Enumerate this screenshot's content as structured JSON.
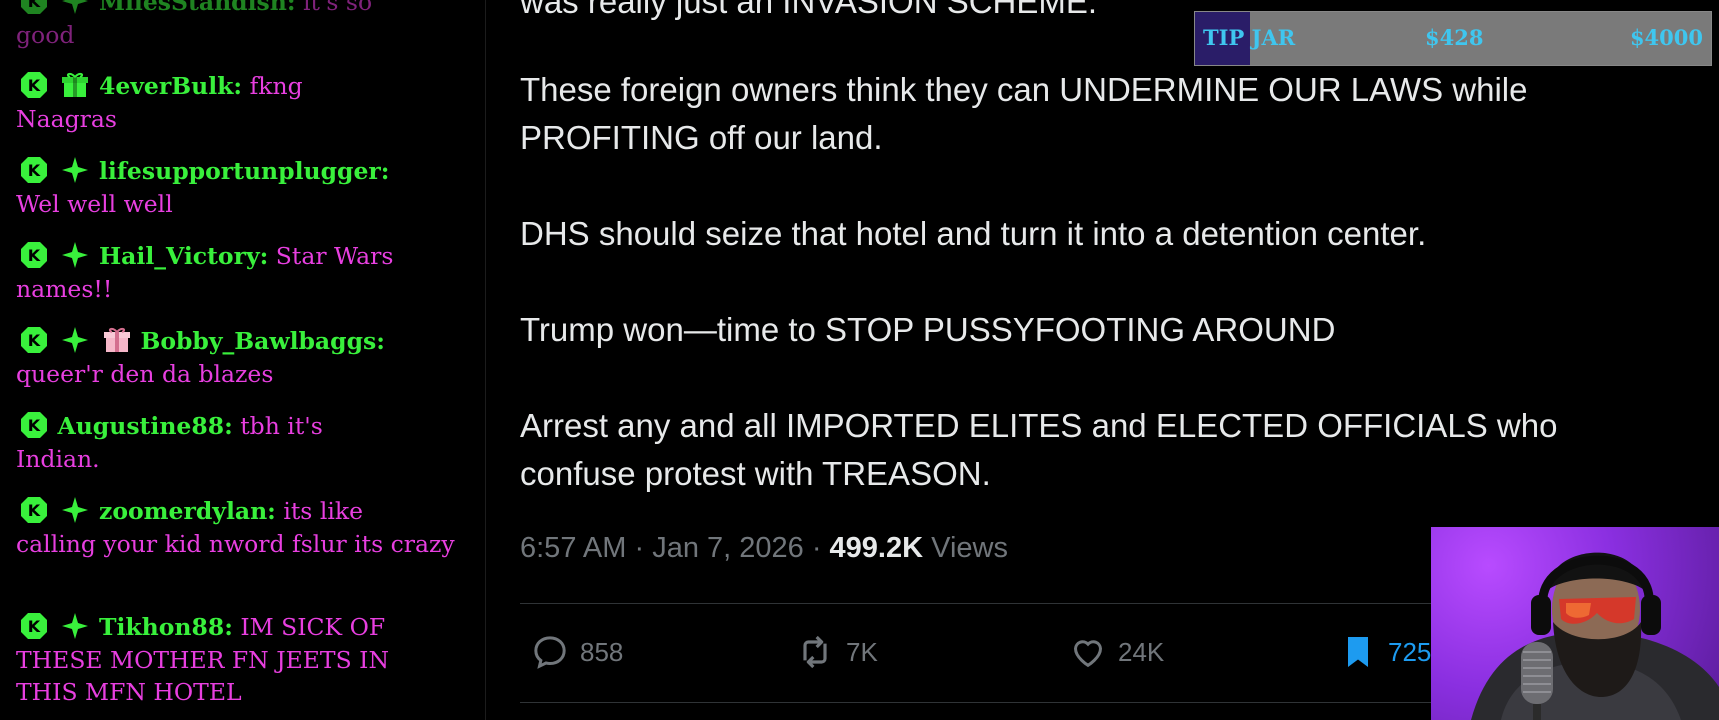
{
  "chat": {
    "messages": [
      {
        "user": "MilesStandish:",
        "text": " it's so",
        "cont": "good",
        "badges": [
          "kick",
          "sparkle"
        ]
      },
      {
        "user": "4everBulk:",
        "text": " fkng",
        "cont": "Naagras",
        "badges": [
          "kick",
          "gift"
        ]
      },
      {
        "user": "lifesupportunplugger:",
        "text": "",
        "cont": "Wel well well",
        "badges": [
          "kick",
          "sparkle"
        ]
      },
      {
        "user": "Hail_Victory:",
        "text": " Star Wars",
        "cont": "names!!",
        "badges": [
          "kick",
          "sparkle"
        ]
      },
      {
        "user": "Bobby_Bawlbaggs:",
        "text": "",
        "cont": "queer'r den da blazes",
        "badges": [
          "kick",
          "sparkle",
          "gift-pink"
        ]
      },
      {
        "user": "Augustine88:",
        "text": " tbh it's",
        "cont": "Indian.",
        "badges": [
          "kick"
        ]
      },
      {
        "user": "zoomerdylan:",
        "text": " its like",
        "cont": "calling your kid nword fslur its crazy",
        "badges": [
          "kick",
          "sparkle"
        ]
      },
      {
        "user": "Tikhon88:",
        "text": " IM SICK OF",
        "cont": "THESE MOTHER FN JEETS IN THIS MFN HOTEL",
        "badges": [
          "kick",
          "sparkle"
        ]
      }
    ]
  },
  "tweet": {
    "top_partial": "was really just an INVASION SCHEME.",
    "p1": "These foreign owners think they can UNDERMINE OUR LAWS while PROFITING off our land.",
    "p2": "DHS should seize that hotel and turn it into a detention center.",
    "p3": "Trump won—time to STOP PUSSYFOOTING AROUND",
    "p4": "Arrest any and all IMPORTED ELITES and ELECTED OFFICIALS who confuse protest with TREASON.",
    "time": "6:57 AM",
    "date": "Jan 7, 2026",
    "views_count": "499.2K",
    "views_label": "Views",
    "sep": " · ",
    "replies": "858",
    "reposts": "7K",
    "likes": "24K",
    "bookmarks": "725",
    "colors": {
      "text": "#e7e9ea",
      "muted": "#71767b",
      "accent": "#1d9bf0"
    }
  },
  "tipjar": {
    "label": "TIP JAR",
    "current": "$428",
    "goal": "$4000",
    "progress": 0.107,
    "colors": {
      "text": "#3fc6ef",
      "fill": "#2a1d68",
      "track": "#7a7a7a"
    }
  },
  "chat_colors": {
    "username": "#39f03c",
    "message": "#e83fe0",
    "badge": "#39f03c"
  }
}
